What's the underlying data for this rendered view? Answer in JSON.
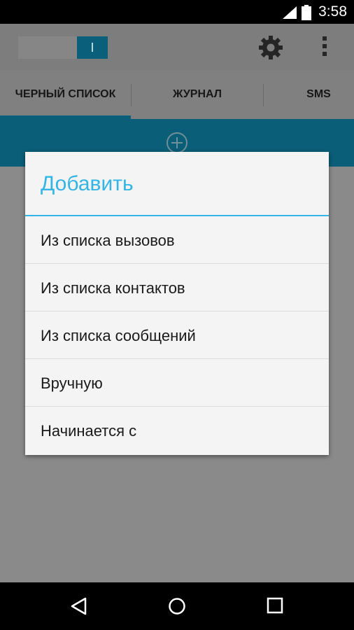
{
  "status_bar": {
    "time": "3:58",
    "icons": [
      "signal-icon",
      "battery-icon"
    ]
  },
  "app_bar": {
    "toggle_knob_label": "I",
    "icons": [
      "gear-icon",
      "overflow-menu-icon"
    ]
  },
  "tabs": [
    {
      "label": "ЧЕРНЫЙ СПИСОК",
      "selected": true
    },
    {
      "label": "ЖУРНАЛ",
      "selected": false
    },
    {
      "label": "SMS",
      "selected": false
    }
  ],
  "add_strip": {
    "icon": "add-circle-icon"
  },
  "dialog": {
    "title": "Добавить",
    "items": [
      {
        "label": "Из списка вызовов"
      },
      {
        "label": "Из списка контактов"
      },
      {
        "label": "Из списка сообщений"
      },
      {
        "label": "Вручную"
      },
      {
        "label": "Начинается с"
      }
    ]
  },
  "nav_bar": {
    "icons": [
      "back-icon",
      "home-icon",
      "recent-apps-icon"
    ]
  },
  "colors": {
    "accent": "#33b5e5",
    "primary_dark": "#0b5e78",
    "dialog_bg": "#f4f4f4"
  }
}
